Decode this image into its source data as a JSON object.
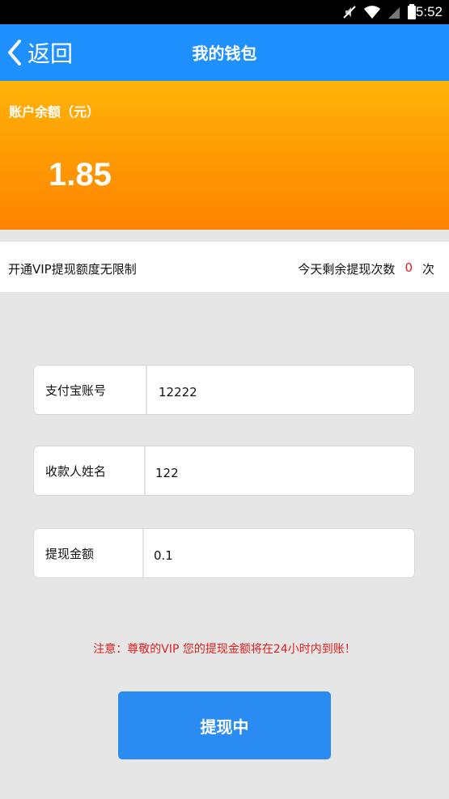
{
  "status_bar": {
    "time": "5:52",
    "icons": [
      "mute-icon",
      "wifi-icon",
      "signal-icon",
      "battery-icon"
    ]
  },
  "nav": {
    "back_label": "返回",
    "title": "我的钱包"
  },
  "balance": {
    "label": "账户余额（元）",
    "value": "1.85"
  },
  "vip_strip": {
    "note": "开通VIP提现额度无限制",
    "remaining_label": "今天剩余提现次数",
    "remaining_count": "0",
    "remaining_unit": "次"
  },
  "form": {
    "alipay": {
      "label": "支付宝账号",
      "value": "12222"
    },
    "name": {
      "label": "收款人姓名",
      "value": "122"
    },
    "amount": {
      "label": "提现金额",
      "value": "0.1"
    }
  },
  "notice": "注意：尊敬的VIP 您的提现金额将在24小时内到账！",
  "button": {
    "label": "提现中"
  },
  "colors": {
    "nav_blue": "#1e90ff",
    "balance_orange_top": "#ffb40a",
    "balance_orange_bottom": "#ff8402",
    "notice_red": "#e02020",
    "button_blue": "#2a8bf2"
  }
}
